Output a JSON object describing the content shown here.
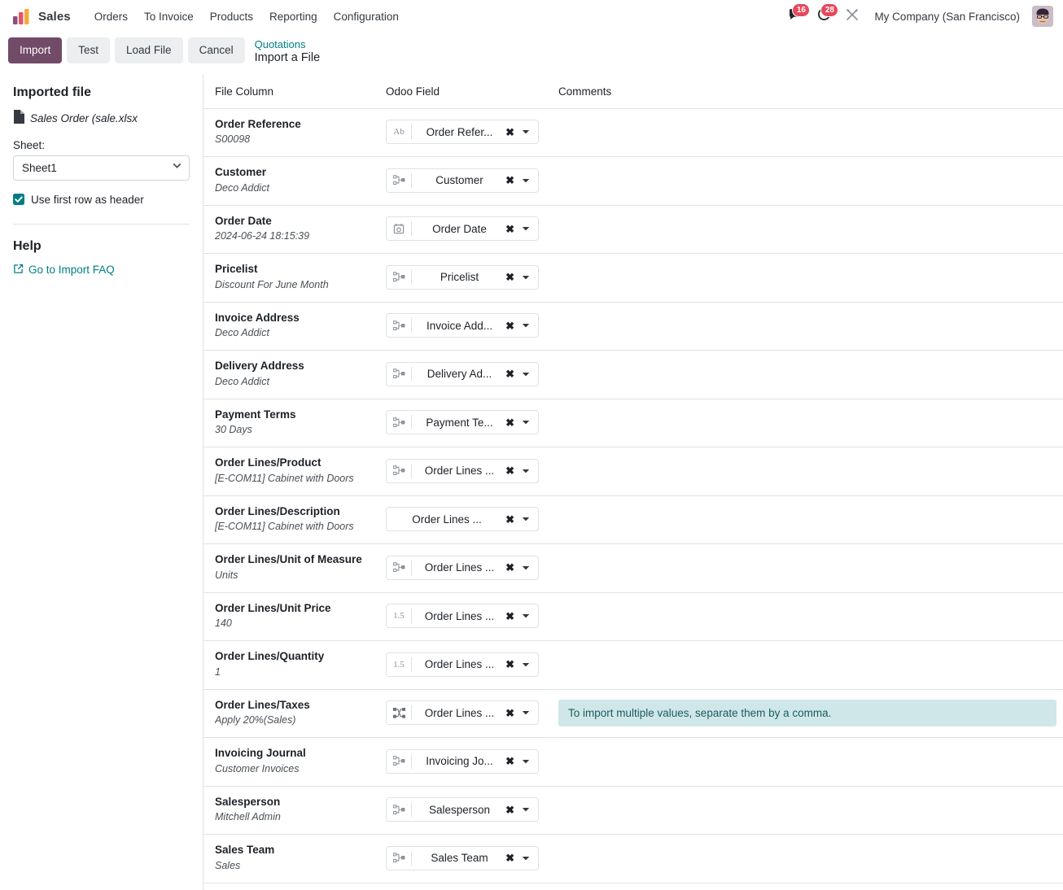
{
  "navbar": {
    "brand": "Sales",
    "app_icon": "sales-bar-chart-icon",
    "menu": [
      "Orders",
      "To Invoice",
      "Products",
      "Reporting",
      "Configuration"
    ],
    "messages_badge": "16",
    "activities_badge": "28",
    "company": "My Company (San Francisco)",
    "icons": {
      "messages": "chat-bubble-icon",
      "activities": "clock-icon",
      "debug": "bug-tools-icon",
      "avatar": "user-avatar"
    }
  },
  "control_panel": {
    "import_label": "Import",
    "test_label": "Test",
    "load_file_label": "Load File",
    "cancel_label": "Cancel",
    "breadcrumb_parent": "Quotations",
    "breadcrumb_current": "Import a File"
  },
  "sidebar": {
    "imported_file_title": "Imported file",
    "file_icon": "file-icon",
    "file_name": "Sales Order (sale.xlsx",
    "sheet_label": "Sheet:",
    "sheet_value": "Sheet1",
    "sheet_options": [
      "Sheet1"
    ],
    "header_checkbox_label": "Use first row as header",
    "header_checkbox_checked": true,
    "help_title": "Help",
    "help_link_label": "Go to Import FAQ",
    "help_link_icon": "external-link-icon"
  },
  "table": {
    "headers": {
      "file_column": "File Column",
      "odoo_field": "Odoo Field",
      "comments": "Comments"
    },
    "rows": [
      {
        "file_column": "Order Reference",
        "sample": "S00098",
        "field_label": "Order Refer...",
        "field_type_icon": "text-ab-icon",
        "field_type_glyph": "Ab",
        "comment": ""
      },
      {
        "file_column": "Customer",
        "sample": "Deco Addict",
        "field_label": "Customer",
        "field_type_icon": "relation-many2one-icon",
        "field_type_glyph": "",
        "comment": ""
      },
      {
        "file_column": "Order Date",
        "sample": "2024-06-24 18:15:39",
        "field_label": "Order Date",
        "field_type_icon": "calendar-icon",
        "field_type_glyph": "",
        "comment": ""
      },
      {
        "file_column": "Pricelist",
        "sample": "Discount For June Month",
        "field_label": "Pricelist",
        "field_type_icon": "relation-many2one-icon",
        "field_type_glyph": "",
        "comment": ""
      },
      {
        "file_column": "Invoice Address",
        "sample": "Deco Addict",
        "field_label": "Invoice Add...",
        "field_type_icon": "relation-many2one-icon",
        "field_type_glyph": "",
        "comment": ""
      },
      {
        "file_column": "Delivery Address",
        "sample": "Deco Addict",
        "field_label": "Delivery Ad...",
        "field_type_icon": "relation-many2one-icon",
        "field_type_glyph": "",
        "comment": ""
      },
      {
        "file_column": "Payment Terms",
        "sample": "30 Days",
        "field_label": "Payment Te...",
        "field_type_icon": "relation-many2one-icon",
        "field_type_glyph": "",
        "comment": ""
      },
      {
        "file_column": "Order Lines/Product",
        "sample": "[E-COM11] Cabinet with Doors",
        "field_label": "Order Lines ...",
        "field_type_icon": "relation-many2one-icon",
        "field_type_glyph": "",
        "comment": ""
      },
      {
        "file_column": "Order Lines/Description",
        "sample": "[E-COM11] Cabinet with Doors",
        "field_label": "Order Lines ...",
        "field_type_icon": "none",
        "field_type_glyph": "",
        "comment": ""
      },
      {
        "file_column": "Order Lines/Unit of Measure",
        "sample": "Units",
        "field_label": "Order Lines ...",
        "field_type_icon": "relation-many2one-icon",
        "field_type_glyph": "",
        "comment": ""
      },
      {
        "file_column": "Order Lines/Unit Price",
        "sample": "140",
        "field_label": "Order Lines ...",
        "field_type_icon": "float-number-icon",
        "field_type_glyph": "1.5",
        "comment": ""
      },
      {
        "file_column": "Order Lines/Quantity",
        "sample": "1",
        "field_label": "Order Lines ...",
        "field_type_icon": "float-number-icon",
        "field_type_glyph": "1.5",
        "comment": ""
      },
      {
        "file_column": "Order Lines/Taxes",
        "sample": "Apply 20%(Sales)",
        "field_label": "Order Lines ...",
        "field_type_icon": "relation-many2many-icon",
        "field_type_glyph": "",
        "comment": "To import multiple values, separate them by a comma."
      },
      {
        "file_column": "Invoicing Journal",
        "sample": "Customer Invoices",
        "field_label": "Invoicing Jo...",
        "field_type_icon": "relation-many2one-icon",
        "field_type_glyph": "",
        "comment": ""
      },
      {
        "file_column": "Salesperson",
        "sample": "Mitchell Admin",
        "field_label": "Salesperson",
        "field_type_icon": "relation-many2one-icon",
        "field_type_glyph": "",
        "comment": ""
      },
      {
        "file_column": "Sales Team",
        "sample": "Sales",
        "field_label": "Sales Team",
        "field_type_icon": "relation-many2one-icon",
        "field_type_glyph": "",
        "comment": ""
      }
    ],
    "clear_glyph": "✖",
    "caret_icon": "chevron-down-icon"
  },
  "colors": {
    "primary": "#714b67",
    "accent_teal": "#017e84",
    "badge_red": "#e6485d",
    "info_banner_bg": "#cfe7e8",
    "info_banner_text": "#1d5b5e",
    "border": "#dee2e6"
  }
}
